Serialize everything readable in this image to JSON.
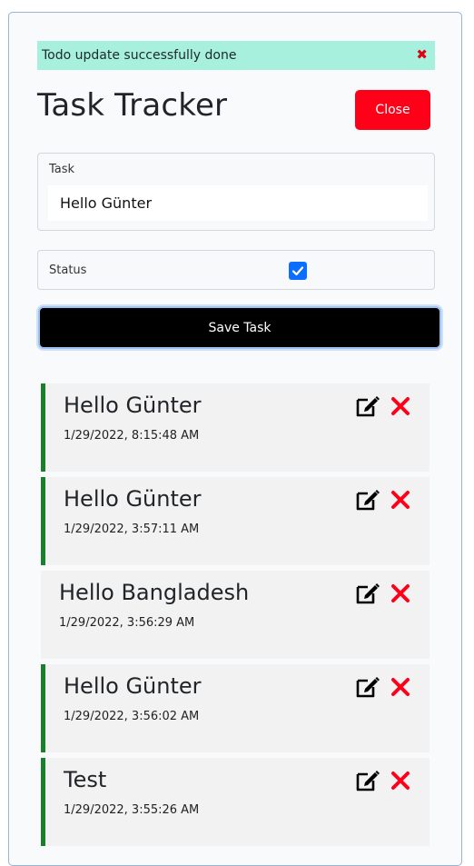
{
  "alert": {
    "message": "Todo update successfully done",
    "close_glyph": "✖"
  },
  "header": {
    "title": "Task Tracker",
    "close_label": "Close"
  },
  "form": {
    "task_label": "Task",
    "task_value": "Hello Günter",
    "status_label": "Status",
    "status_checked": true,
    "save_label": "Save Task"
  },
  "tasks": [
    {
      "title": "Hello Günter",
      "date": "1/29/2022, 8:15:48 AM",
      "done": true
    },
    {
      "title": "Hello Günter",
      "date": "1/29/2022, 3:57:11 AM",
      "done": true
    },
    {
      "title": "Hello Bangladesh",
      "date": "1/29/2022, 3:56:29 AM",
      "done": false
    },
    {
      "title": "Hello Günter",
      "date": "1/29/2022, 3:56:02 AM",
      "done": true
    },
    {
      "title": "Test",
      "date": "1/29/2022, 3:55:26 AM",
      "done": true
    }
  ],
  "colors": {
    "accent": "#0d6efd",
    "danger": "#ff0019",
    "done_border": "#1a7f2a",
    "alert_bg": "#a7f0dd"
  },
  "icons": {
    "edit": "edit-icon",
    "delete": "x-icon",
    "check": "checkmark-icon"
  }
}
